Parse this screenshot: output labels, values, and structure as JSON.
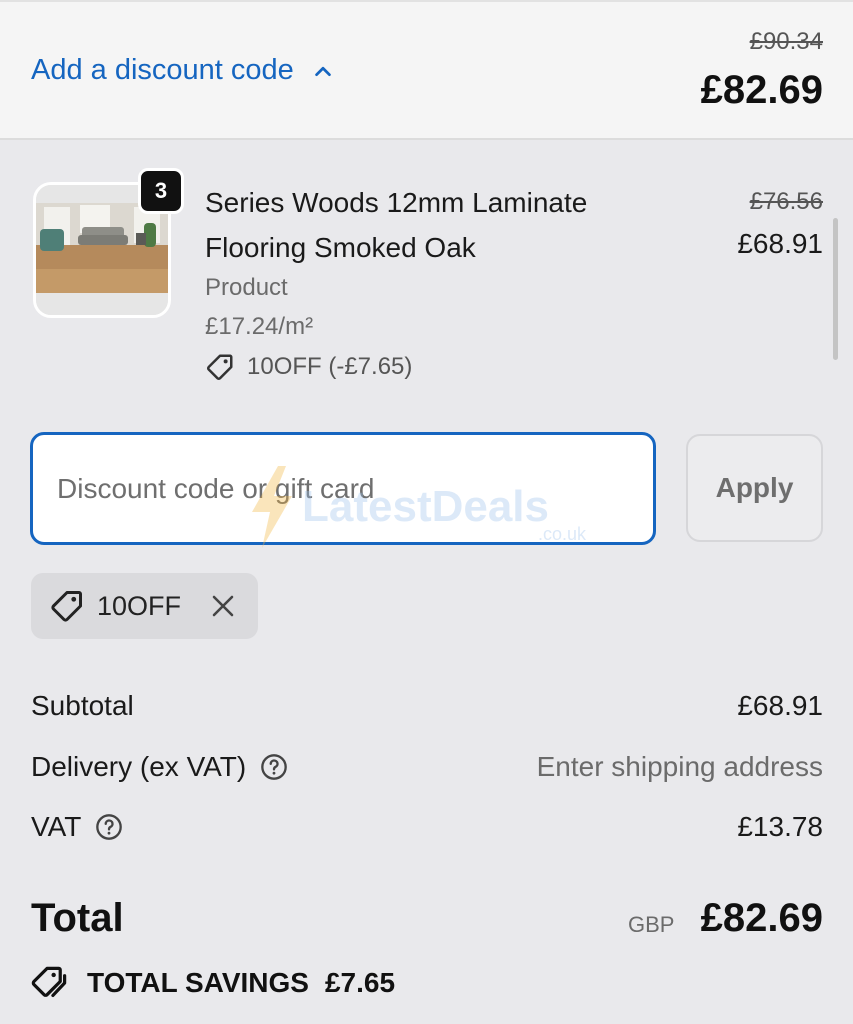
{
  "header": {
    "discount_toggle_label": "Add a discount code",
    "original_total": "£90.34",
    "total": "£82.69"
  },
  "line_item": {
    "quantity": "3",
    "title": "Series Woods 12mm Laminate Flooring Smoked Oak",
    "type": "Product",
    "unit_price": "£17.24/m²",
    "discount": "10OFF (-£7.65)",
    "original_price": "£76.56",
    "price": "£68.91"
  },
  "discount_form": {
    "placeholder": "Discount code or gift card",
    "apply_label": "Apply",
    "applied_code": "10OFF"
  },
  "watermark": {
    "text": "LatestDeals",
    "sub": ".co.uk"
  },
  "summary": {
    "subtotal_label": "Subtotal",
    "subtotal_value": "£68.91",
    "delivery_label": "Delivery (ex VAT)",
    "delivery_value": "Enter shipping address",
    "vat_label": "VAT",
    "vat_value": "£13.78",
    "total_label": "Total",
    "total_currency": "GBP",
    "total_value": "£82.69",
    "savings_label": "TOTAL SAVINGS",
    "savings_value": "£7.65"
  },
  "icons": {
    "toggle": "chevron-up-icon",
    "tag": "tag-icon",
    "close": "close-icon",
    "help": "help-circle-icon",
    "savings": "tags-icon"
  },
  "colors": {
    "accent": "#1565c0",
    "background": "#e9e9ec",
    "header_background": "#f5f5f5"
  }
}
